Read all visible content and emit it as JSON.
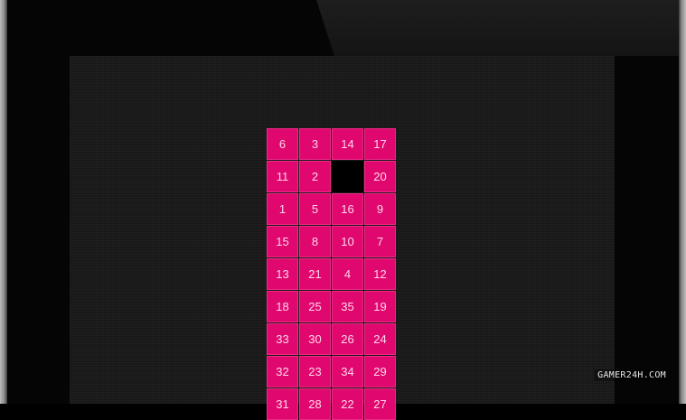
{
  "puzzle": {
    "columns": 4,
    "tiles": [
      "6",
      "3",
      "14",
      "17",
      "11",
      "2",
      "",
      "20",
      "1",
      "5",
      "16",
      "9",
      "15",
      "8",
      "10",
      "7",
      "13",
      "21",
      "4",
      "12",
      "18",
      "25",
      "35",
      "19",
      "33",
      "30",
      "26",
      "24",
      "32",
      "23",
      "34",
      "29",
      "31",
      "28",
      "22",
      "27"
    ],
    "empty_index": 6
  },
  "watermark": {
    "text": "GAMER24H.COM"
  },
  "colors": {
    "tile": "#e0086f",
    "tile_text": "#ffd6ea",
    "board_background": "#1c1c1c",
    "empty_slot": "#000000"
  }
}
